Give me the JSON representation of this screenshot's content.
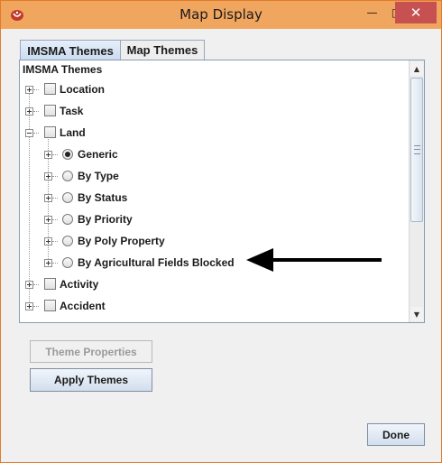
{
  "window": {
    "title": "Map Display",
    "minimize_label": "—",
    "maximize_label": "□",
    "close_label": "✕"
  },
  "tabs": [
    {
      "label": "IMSMA Themes",
      "active": true
    },
    {
      "label": "Map Themes",
      "active": false
    }
  ],
  "tree": {
    "root_label": "IMSMA Themes",
    "nodes": [
      {
        "label": "Location",
        "control": "checkbox",
        "checked": false,
        "expander": "plus"
      },
      {
        "label": "Task",
        "control": "checkbox",
        "checked": false,
        "expander": "plus"
      },
      {
        "label": "Land",
        "control": "checkbox",
        "checked": false,
        "expander": "minus",
        "children": [
          {
            "label": "Generic",
            "control": "radio",
            "selected": true,
            "expander": "plus"
          },
          {
            "label": "By Type",
            "control": "radio",
            "selected": false,
            "expander": "plus"
          },
          {
            "label": "By Status",
            "control": "radio",
            "selected": false,
            "expander": "plus"
          },
          {
            "label": "By Priority",
            "control": "radio",
            "selected": false,
            "expander": "plus"
          },
          {
            "label": "By Poly Property",
            "control": "radio",
            "selected": false,
            "expander": "plus"
          },
          {
            "label": "By Agricultural Fields Blocked",
            "control": "radio",
            "selected": false,
            "expander": "plus"
          }
        ]
      },
      {
        "label": "Activity",
        "control": "checkbox",
        "checked": false,
        "expander": "plus"
      },
      {
        "label": "Accident",
        "control": "checkbox",
        "checked": false,
        "expander": "plus"
      }
    ]
  },
  "buttons": {
    "theme_properties": {
      "label": "Theme Properties",
      "enabled": false
    },
    "apply_themes": {
      "label": "Apply Themes",
      "enabled": true
    },
    "done": {
      "label": "Done",
      "enabled": true
    }
  },
  "colors": {
    "titlebar": "#f1a660",
    "window_border": "#e27b2b",
    "close_button": "#c75050"
  },
  "icons": {
    "app": "imsma-app-icon",
    "annotation": "arrow-left-icon"
  }
}
